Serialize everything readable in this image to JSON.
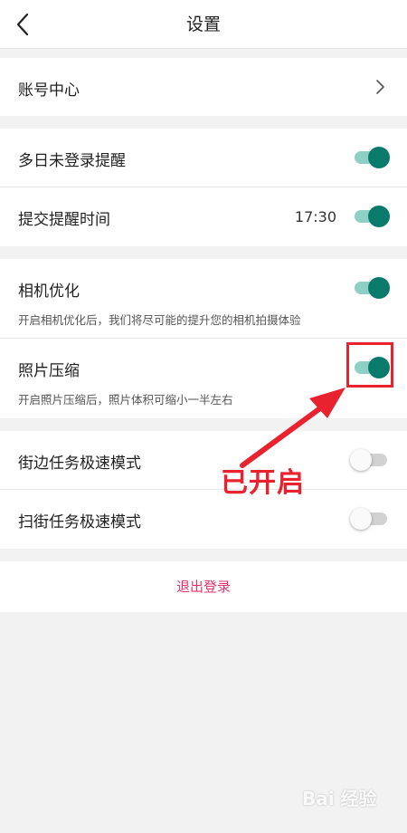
{
  "header": {
    "title": "设置"
  },
  "account": {
    "label": "账号中心"
  },
  "reminders": {
    "login_reminder": {
      "label": "多日未登录提醒",
      "enabled": true
    },
    "submit_reminder": {
      "label": "提交提醒时间",
      "time": "17:30",
      "enabled": true
    }
  },
  "camera": {
    "optimization": {
      "label": "相机优化",
      "description": "开启相机优化后，我们将尽可能的提升您的相机拍摄体验",
      "enabled": true
    },
    "compression": {
      "label": "照片压缩",
      "description": "开启照片压缩后，照片体积可缩小一半左右",
      "enabled": true
    }
  },
  "speed_modes": {
    "street_task": {
      "label": "街边任务极速模式",
      "enabled": false
    },
    "sweep_task": {
      "label": "扫街任务极速模式",
      "enabled": false
    }
  },
  "logout": {
    "label": "退出登录"
  },
  "annotation": {
    "text": "已开启"
  },
  "watermark": {
    "text": "Bai 经验"
  },
  "colors": {
    "toggle_on_knob": "#0a7a6a",
    "toggle_on_track": "#8fd0c5",
    "toggle_off_track": "#d2d2d2",
    "annotation_red": "#e8232f",
    "logout_pink": "#e8336a"
  }
}
